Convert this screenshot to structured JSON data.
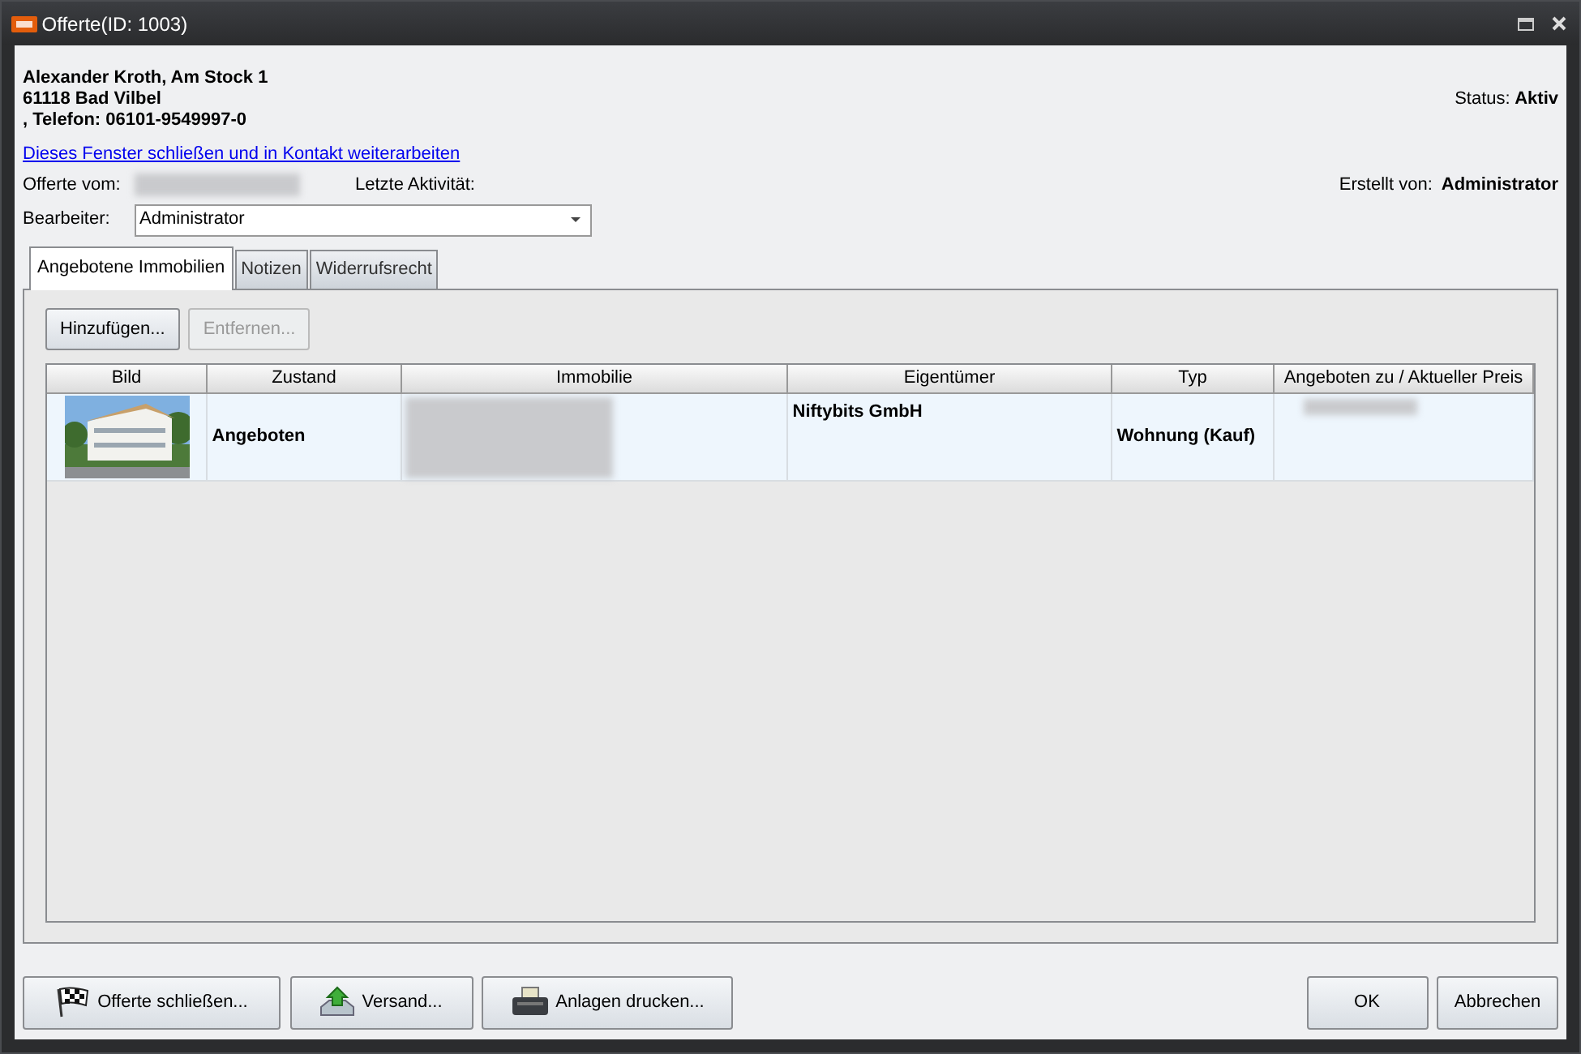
{
  "window": {
    "title": "Offerte(ID: 1003)"
  },
  "address": [
    "Alexander Kroth, Am Stock 1",
    "61118 Bad Vilbel",
    ", Telefon: 06101-9549997-0"
  ],
  "status": {
    "label": "Status:",
    "value": "Aktiv"
  },
  "link": "Dieses Fenster schließen und in Kontakt weiterarbeiten",
  "offerte_vom": {
    "label": "Offerte vom:"
  },
  "letzte_aktivitaet": {
    "label": "Letzte Aktivität:"
  },
  "erstellt_von": {
    "label": "Erstellt von:",
    "value": "Administrator"
  },
  "bearbeiter": {
    "label": "Bearbeiter:",
    "value": "Administrator"
  },
  "tabs": [
    {
      "label": "Angebotene Immobilien",
      "selected": true
    },
    {
      "label": "Notizen",
      "selected": false
    },
    {
      "label": "Widerrufsrecht",
      "selected": false
    }
  ],
  "toolbar": [
    {
      "label": "Hinzufügen...",
      "disabled": false
    },
    {
      "label": "Entfernen...",
      "disabled": true
    }
  ],
  "table": {
    "columns": [
      "Bild",
      "Zustand",
      "Immobilie",
      "Eigentümer",
      "Typ",
      "Angeboten zu / Aktueller Preis"
    ],
    "rows": [
      {
        "zustand": "Angeboten",
        "eigentuemer": "Niftybits GmbH",
        "typ": "Wohnung (Kauf)"
      }
    ]
  },
  "footer_left": [
    {
      "label": "Offerte schließen...",
      "kind": "flag"
    },
    {
      "label": "Versand...",
      "kind": "send"
    },
    {
      "label": "Anlagen drucken...",
      "kind": "printer"
    }
  ],
  "footer_right": [
    {
      "label": "OK"
    },
    {
      "label": "Abbrechen"
    }
  ]
}
